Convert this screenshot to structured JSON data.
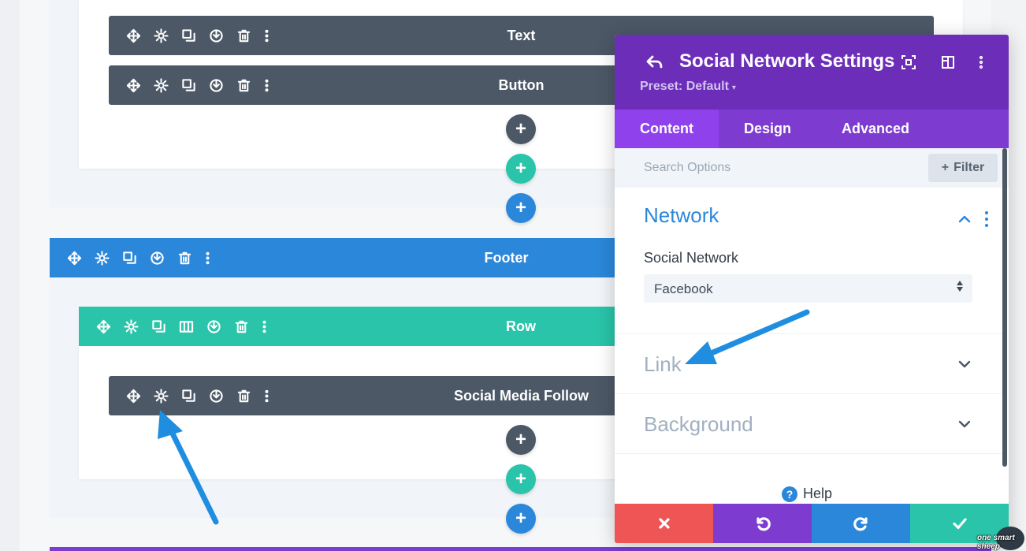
{
  "colors": {
    "module_bar": "#4c5866",
    "section_bar": "#2b87da",
    "row_bar": "#29c4a9",
    "modal_header": "#6c2eb9",
    "modal_tabs": "#7e3bd0",
    "active_tab": "#8f42ec",
    "discard": "#ef5555",
    "save": "#29c4a9",
    "annotation_arrow": "#1f8ee0"
  },
  "builder": {
    "modules": {
      "text_label": "Text",
      "button_label": "Button",
      "social_label": "Social Media Follow"
    },
    "section_label": "Footer",
    "row_label": "Row",
    "add_symbol": "+",
    "module_tools": [
      "move-icon",
      "gear-icon",
      "duplicate-icon",
      "save-to-library-icon",
      "trash-icon",
      "more-icon"
    ],
    "row_tools": [
      "move-icon",
      "gear-icon",
      "duplicate-icon",
      "columns-icon",
      "save-to-library-icon",
      "trash-icon",
      "more-icon"
    ]
  },
  "modal": {
    "title": "Social Network Settings",
    "preset": "Preset: Default",
    "preset_caret": "▾",
    "tabs": [
      {
        "label": "Content",
        "active": true
      },
      {
        "label": "Design",
        "active": false
      },
      {
        "label": "Advanced",
        "active": false
      }
    ],
    "search_placeholder": "Search Options",
    "filter_label": "Filter",
    "filter_symbol": "+",
    "groups": {
      "network": {
        "title": "Network",
        "state": "open"
      },
      "link": {
        "title": "Link",
        "state": "closed"
      },
      "background": {
        "title": "Background",
        "state": "closed"
      }
    },
    "field": {
      "label": "Social Network",
      "value": "Facebook"
    },
    "help_symbol": "?",
    "help_label": "Help"
  },
  "watermark": {
    "text": "one smart sheep"
  }
}
